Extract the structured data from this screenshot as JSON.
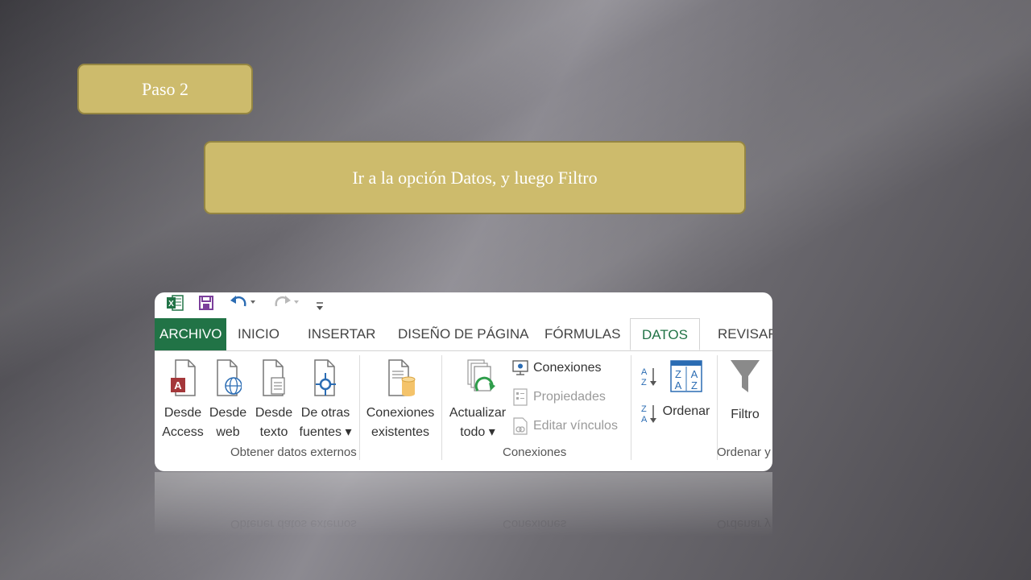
{
  "step": {
    "label": "Paso 2"
  },
  "instruction": {
    "text": "Ir a la opción Datos, y luego Filtro"
  },
  "excel": {
    "qat": [
      "excel-logo-icon",
      "save-icon",
      "undo-icon",
      "redo-icon",
      "customize-qat-icon"
    ],
    "tabs": [
      "ARCHIVO",
      "INICIO",
      "INSERTAR",
      "DISEÑO DE PÁGINA",
      "FÓRMULAS",
      "DATOS",
      "REVISAR"
    ],
    "active_tab": "DATOS",
    "groups": {
      "obtener": {
        "label": "Obtener datos externos",
        "buttons": [
          {
            "line1": "Desde",
            "line2": "Access",
            "icon": "access-file-icon"
          },
          {
            "line1": "Desde",
            "line2": "web",
            "icon": "web-file-icon"
          },
          {
            "line1": "Desde",
            "line2": "texto",
            "icon": "text-file-icon"
          },
          {
            "line1": "De otras",
            "line2": "fuentes ▾",
            "icon": "other-sources-icon"
          },
          {
            "line1": "Conexiones",
            "line2": "existentes",
            "icon": "existing-connections-icon"
          }
        ]
      },
      "conexiones": {
        "label": "Conexiones",
        "refresh": {
          "line1": "Actualizar",
          "line2": "todo ▾",
          "icon": "refresh-all-icon"
        },
        "connections": "Conexiones",
        "properties": "Propiedades",
        "edit_links": "Editar vínculos"
      },
      "ordenar": {
        "label": "Ordenar y",
        "sort": "Ordenar",
        "filter": "Filtro"
      }
    },
    "colors": {
      "accent": "#217346",
      "box_fill": "#cdbb6c",
      "box_border": "#958642"
    }
  }
}
